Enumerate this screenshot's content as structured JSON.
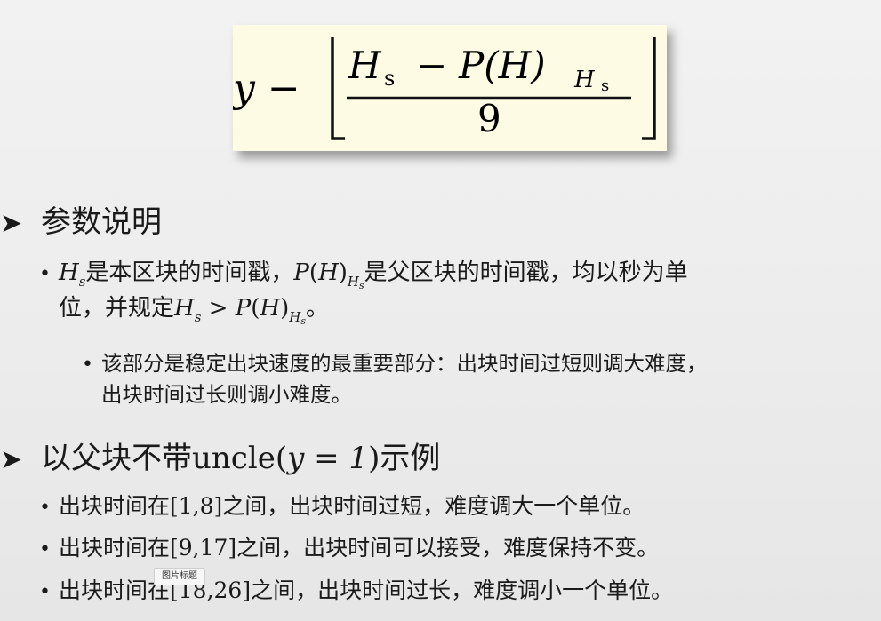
{
  "formula": {
    "prefix": "y −",
    "numerator_a": "H",
    "numerator_a_sub": "s",
    "minus": "−",
    "numerator_b": "P(H)",
    "numerator_b_sub": "H",
    "numerator_b_subsub": "s",
    "denominator": "9"
  },
  "section1": {
    "heading": "参数说明",
    "bullet1": {
      "part1": "是本区块的时间戳，",
      "part2": "是父区块的时间戳，均以秒为单",
      "part3": "位，并规定",
      "cond_rel": " > ",
      "part4": "。"
    },
    "bullet1_sub": {
      "line1": "该部分是稳定出块速度的最重要部分：出块时间过短则调大难度，",
      "line2": "出块时间过长则调小难度。"
    }
  },
  "section2": {
    "heading_pre": "以父块不带uncle(",
    "heading_math": "y = 1",
    "heading_post": ")示例",
    "items": [
      "出块时间在[1,8]之间，出块时间过短，难度调大一个单位。",
      "出块时间在[9,17]之间，出块时间可以接受，难度保持不变。",
      "出块时间在[18,26]之间，出块时间过长，难度调小一个单位。"
    ]
  },
  "caption": "图片标题"
}
